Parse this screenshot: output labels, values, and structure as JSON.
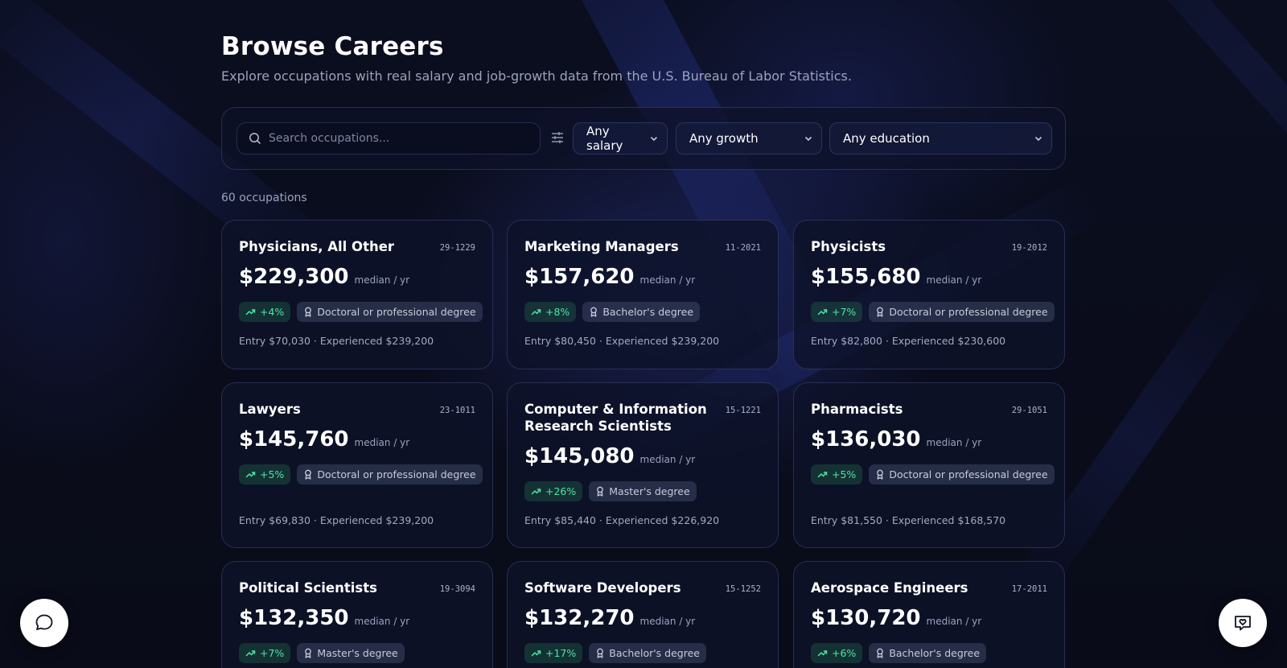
{
  "header": {
    "title": "Browse Careers",
    "subtitle": "Explore occupations with real salary and job-growth data from the U.S. Bureau of Labor Statistics."
  },
  "filters": {
    "search_placeholder": "Search occupations...",
    "search_icon": "search-icon",
    "filter_icon": "sliders-icon",
    "salary": "Any salary",
    "growth": "Any growth",
    "education": "Any education"
  },
  "results": {
    "count": "60 occupations"
  },
  "labels": {
    "per_year": "median / yr"
  },
  "cards": [
    {
      "name": "Physicians, All Other",
      "code": "29-1229",
      "salary": "$229,300",
      "growth": "+4%",
      "education": "Doctoral or professional degree",
      "range": "Entry $70,030 · Experienced $239,200"
    },
    {
      "name": "Marketing Managers",
      "code": "11-2021",
      "salary": "$157,620",
      "growth": "+8%",
      "education": "Bachelor's degree",
      "range": "Entry $80,450 · Experienced $239,200"
    },
    {
      "name": "Physicists",
      "code": "19-2012",
      "salary": "$155,680",
      "growth": "+7%",
      "education": "Doctoral or professional degree",
      "range": "Entry $82,800 · Experienced $230,600"
    },
    {
      "name": "Lawyers",
      "code": "23-1011",
      "salary": "$145,760",
      "growth": "+5%",
      "education": "Doctoral or professional degree",
      "range": "Entry $69,830 · Experienced $239,200"
    },
    {
      "name": "Computer & Information Research Scientists",
      "code": "15-1221",
      "salary": "$145,080",
      "growth": "+26%",
      "education": "Master's degree",
      "range": "Entry $85,440 · Experienced $226,920"
    },
    {
      "name": "Pharmacists",
      "code": "29-1051",
      "salary": "$136,030",
      "growth": "+5%",
      "education": "Doctoral or professional degree",
      "range": "Entry $81,550 · Experienced $168,570"
    },
    {
      "name": "Political Scientists",
      "code": "19-3094",
      "salary": "$132,350",
      "growth": "+7%",
      "education": "Master's degree",
      "range": ""
    },
    {
      "name": "Software Developers",
      "code": "15-1252",
      "salary": "$132,270",
      "growth": "+17%",
      "education": "Bachelor's degree",
      "range": ""
    },
    {
      "name": "Aerospace Engineers",
      "code": "17-2011",
      "salary": "$130,720",
      "growth": "+6%",
      "education": "Bachelor's degree",
      "range": ""
    }
  ],
  "fab": {
    "chat_icon": "chat-bubble-icon",
    "feedback_icon": "feedback-heart-icon"
  },
  "colors": {
    "accent_green": "#4fe3a6",
    "background": "#0a0c1a",
    "card": "#0e122a"
  }
}
